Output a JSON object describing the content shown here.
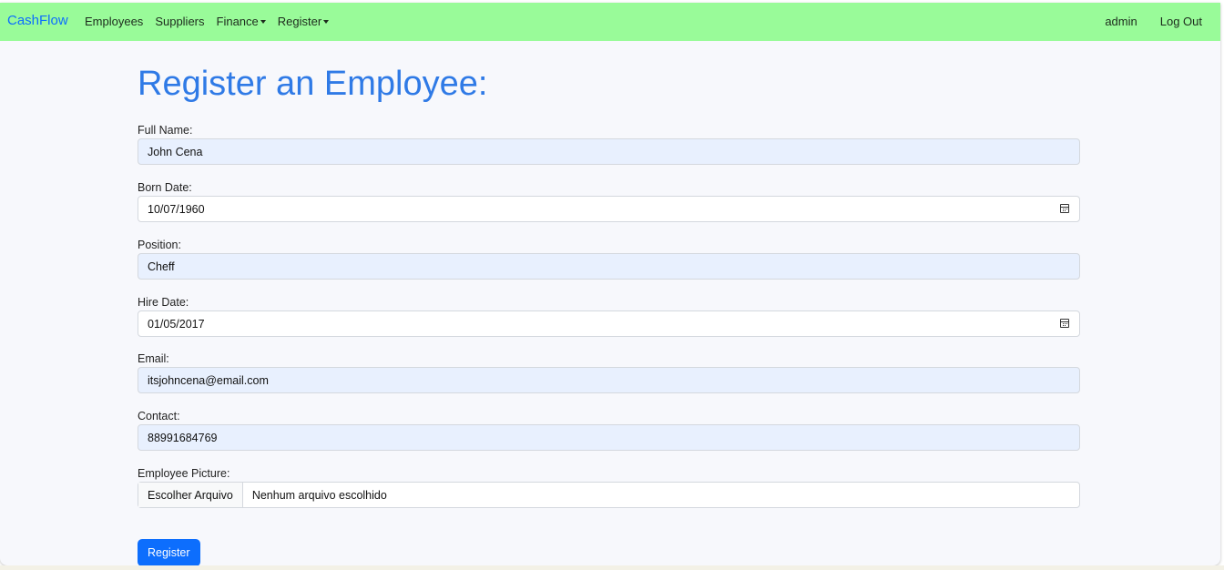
{
  "navbar": {
    "brand": "CashFlow",
    "links": [
      "Employees",
      "Suppliers"
    ],
    "dropdowns": [
      "Finance",
      "Register"
    ],
    "user": "admin",
    "logout": "Log Out"
  },
  "page": {
    "title": "Register an Employee:"
  },
  "form": {
    "full_name": {
      "label": "Full Name:",
      "value": "John Cena"
    },
    "born_date": {
      "label": "Born Date:",
      "value": "10/07/1960"
    },
    "position": {
      "label": "Position:",
      "value": "Cheff"
    },
    "hire_date": {
      "label": "Hire Date:",
      "value": "01/05/2017"
    },
    "email": {
      "label": "Email:",
      "value": "itsjohncena@email.com"
    },
    "contact": {
      "label": "Contact:",
      "value": "88991684769"
    },
    "picture": {
      "label": "Employee Picture:",
      "button": "Escolher Arquivo",
      "status": "Nenhum arquivo escolhido"
    },
    "submit": "Register"
  },
  "colors": {
    "navbar_bg": "#99fb99",
    "brand": "#0d6efd",
    "title": "#2f7ae6",
    "autofill_bg": "#e8f0fe",
    "submit_bg": "#0d6efd"
  }
}
